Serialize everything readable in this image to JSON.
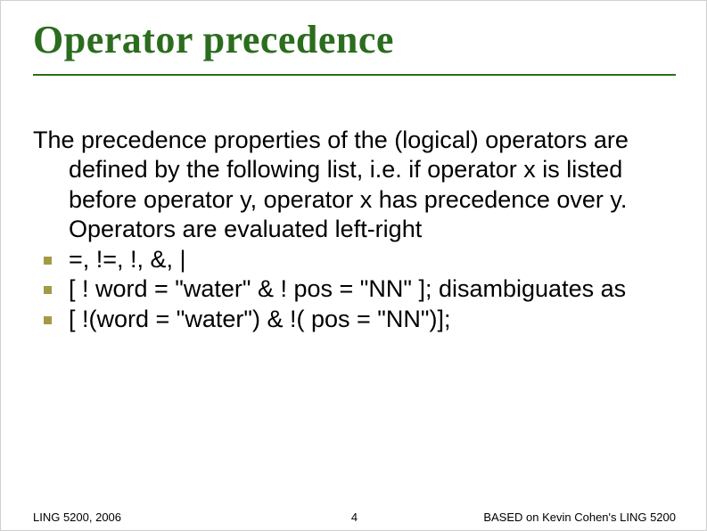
{
  "title": "Operator precedence",
  "intro": "The precedence properties of the (logical) operators are defined by the following list, i.e. if operator x is listed before operator y, operator x has precedence over y.  Operators are evaluated left-right",
  "bullets": [
    "=, !=, !, &, |",
    "[ ! word = \"water\" & ! pos = \"NN\" ]; disambiguates as",
    "[ !(word = \"water\") & !( pos = \"NN\")];"
  ],
  "footer": {
    "left": "LING 5200, 2006",
    "center": "4",
    "right": "BASED on Kevin Cohen's LING 5200"
  }
}
